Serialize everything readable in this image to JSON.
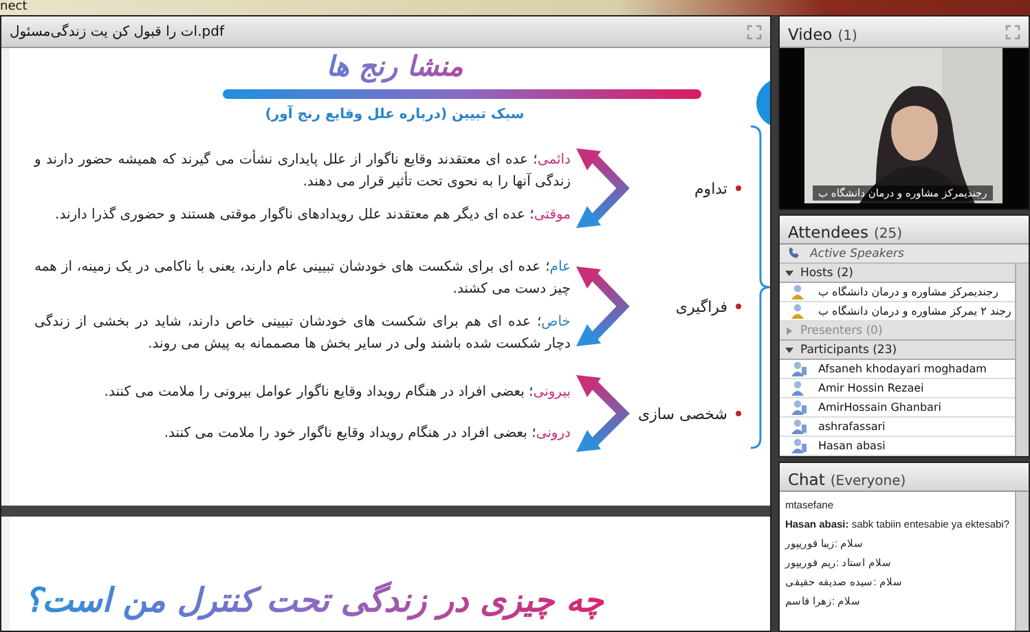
{
  "window": {
    "title": "nect"
  },
  "document": {
    "title": "ات را قبول کن یت زندگی‌مسئول.pdf",
    "slide_1": {
      "title": "منشا رنج ها",
      "subtitle": "سبک تبیین (درباره علل وقایع رنج آور)",
      "groups": [
        {
          "label": "تداوم",
          "items": [
            {
              "term": "دائمی",
              "color": "#c2307a",
              "text": "؛ عده ای معتقدند وقایع ناگوار از علل پایداری نشأت می گیرند که  همیشه حضور دارند و زندگی آنها را به نحوی تحت تأثیر قرار می دهند."
            },
            {
              "term": "موقتی",
              "color": "#c2307a",
              "text": "؛ عده ای دیگر هم معتقدند علل رویدادهای ناگوار موقتی هستند و حضوری گذرا دارند."
            }
          ]
        },
        {
          "label": "فراگیری",
          "items": [
            {
              "term": "عام",
              "color": "#2a7fc4",
              "text": "؛ عده ای برای شکست های خودشان تبیینی عام دارند، یعنی با ناکامی در یک زمینه، از همه چیز دست می کشند."
            },
            {
              "term": "خاص",
              "color": "#2a7fc4",
              "text": "؛ عده ای هم برای شکست های خودشان تبیینی خاص دارند، شاید در بخشی از زندگی دچار شکست شده باشند ولی در سایر بخش ها مصممانه به پیش می روند."
            }
          ]
        },
        {
          "label": "شخصی سازی",
          "items": [
            {
              "term": "بیرونی",
              "color": "#c2307a",
              "text": "؛ بعضی افراد در هنگام رویداد وقایع ناگوار عوامل بیرونی را ملامت می کنند."
            },
            {
              "term": "درونی",
              "color": "#c2307a",
              "text": "؛ بعضی افراد در هنگام رویداد وقایع ناگوار خود را ملامت می کنند."
            }
          ]
        }
      ]
    },
    "slide_2": {
      "title": "چه چیزی در زندگی تحت کنترل من است؟"
    }
  },
  "video": {
    "title": "Video",
    "count": "(1)",
    "caption": "رجندیمرکز مشاوره و درمان دانشگاه ب"
  },
  "attendees": {
    "title": "Attendees",
    "count": "(25)",
    "active_speakers": "Active Speakers",
    "sections": [
      {
        "label": "Hosts (2)",
        "expanded": true,
        "people": [
          {
            "name": "رجندیمرکز مشاوره و درمان دانشگاه ب",
            "kind": "host"
          },
          {
            "name": "رجند ۲ یمرکز مشاوره و درمان دانشگاه ب",
            "kind": "host"
          }
        ]
      },
      {
        "label": "Presenters (0)",
        "expanded": false
      },
      {
        "label": "Participants (23)",
        "expanded": true,
        "people": [
          {
            "name": "Afsaneh khodayari moghadam",
            "kind": "guest"
          },
          {
            "name": "Amir Hossin Rezaei",
            "kind": "user"
          },
          {
            "name": "AmirHossain Ghanbari",
            "kind": "guest"
          },
          {
            "name": "ashrafassari",
            "kind": "guest"
          },
          {
            "name": "Hasan abasi",
            "kind": "guest"
          }
        ]
      }
    ]
  },
  "chat": {
    "title": "Chat",
    "scope": "(Everyone)",
    "messages": [
      {
        "text": "mtasefane"
      },
      {
        "text": "**Hasan abasi:** sabk tabiin entesabie ya ektesabi?"
      },
      {
        "text": "سلام :زیبا قوریپور"
      },
      {
        "text": "سلام استاد :ریم قوریپور"
      },
      {
        "text": "سلام :سیده صدیقه حقیقی"
      },
      {
        "text": "سلام :زهرا قاسم"
      }
    ]
  }
}
